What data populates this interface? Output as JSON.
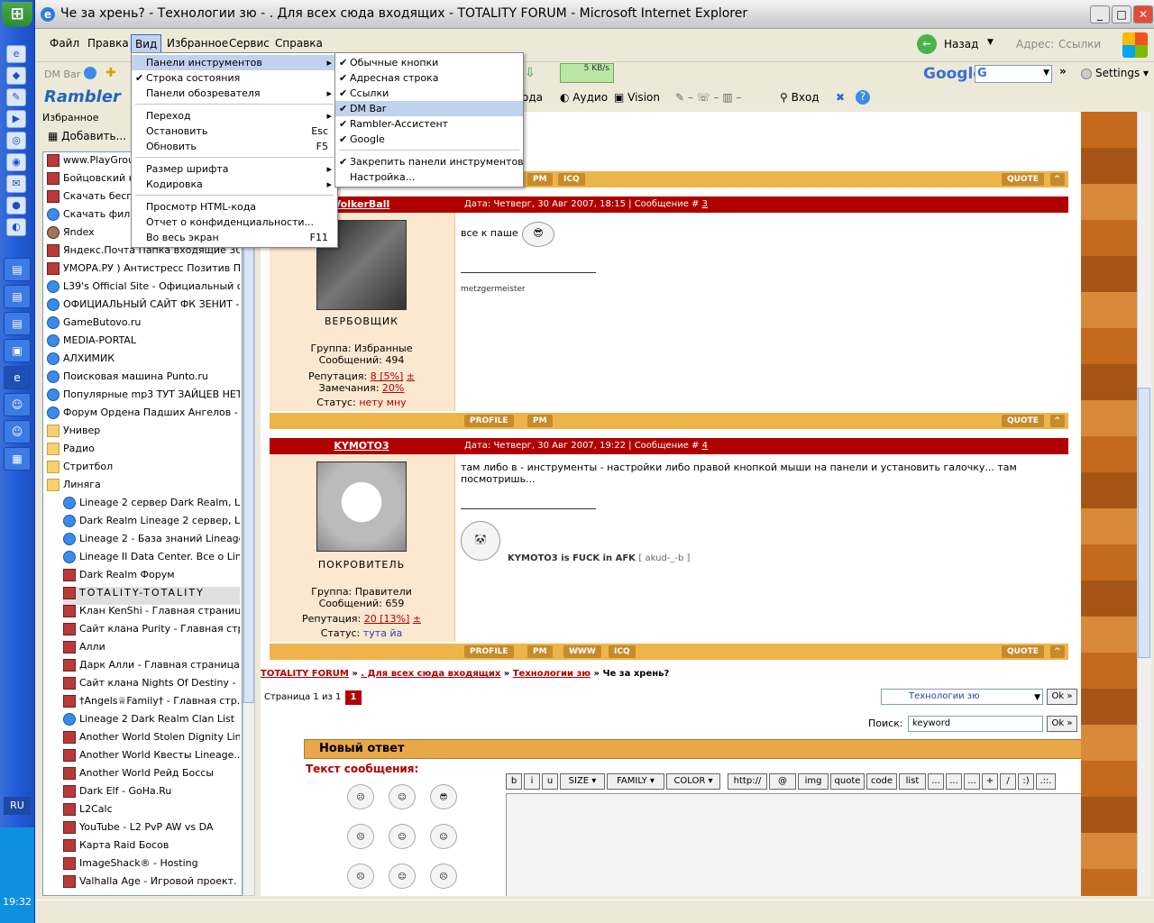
{
  "window": {
    "title": "Че за хрень? - Технологии зю - . Для всех сюда входящих - TOTALITY FORUM - Microsoft Internet Explorer"
  },
  "taskbar": {
    "lang": "RU",
    "clock": "19:32"
  },
  "menubar": {
    "items": [
      "Файл",
      "Правка",
      "Вид",
      "Избранное",
      "Сервис",
      "Справка"
    ]
  },
  "nav": {
    "back": "Назад",
    "address": "Адрес:",
    "links": "Ссылки"
  },
  "toolbar": {
    "dm_bar": "DM Bar",
    "speed": "5 KB/s",
    "google": "Google",
    "settings": "Settings"
  },
  "rambler": {
    "logo": "Rambler",
    "items": [
      "ода",
      "Аудио",
      "Vision",
      "Вход"
    ]
  },
  "view_menu": {
    "items": [
      {
        "label": "Панели инструментов",
        "arrow": true,
        "hl": true
      },
      {
        "label": "Строка состояния",
        "check": true
      },
      {
        "label": "Панели обозревателя",
        "arrow": true
      },
      {
        "label": "Переход",
        "arrow": true
      },
      {
        "label": "Остановить",
        "shortcut": "Esc"
      },
      {
        "label": "Обновить",
        "shortcut": "F5"
      },
      {
        "label": "Размер шрифта",
        "arrow": true
      },
      {
        "label": "Кодировка",
        "arrow": true
      },
      {
        "label": "Просмотр HTML-кода"
      },
      {
        "label": "Отчет о конфиденциальности..."
      },
      {
        "label": "Во весь экран",
        "shortcut": "F11"
      }
    ]
  },
  "toolbars_menu": {
    "items": [
      {
        "label": "Обычные кнопки",
        "check": true
      },
      {
        "label": "Адресная строка",
        "check": true
      },
      {
        "label": "Ссылки",
        "check": true
      },
      {
        "label": "DM Bar",
        "check": true,
        "hl": true
      },
      {
        "label": "Rambler-Ассистент",
        "check": true
      },
      {
        "label": "Google",
        "check": true
      },
      {
        "label": "Закрепить панели инструментов",
        "check": true
      },
      {
        "label": "Настройка..."
      }
    ]
  },
  "favorites": {
    "header": "Избранное",
    "add": "Добавить...",
    "items": [
      {
        "label": "www.PlayGrou",
        "t": "r"
      },
      {
        "label": "Бойцовский кл",
        "t": "r"
      },
      {
        "label": "Скачать бесп",
        "t": "r"
      },
      {
        "label": "Скачать филь",
        "t": "ie"
      },
      {
        "label": "Яndex",
        "t": "ya"
      },
      {
        "label": "Яндекс.Почта Папка входящие 30 ...",
        "t": "r"
      },
      {
        "label": "УМОРА.РУ ) Антистресс Позитив П...",
        "t": "r"
      },
      {
        "label": "L39's Official Site - Официальный са...",
        "t": "ie"
      },
      {
        "label": "ОФИЦИАЛЬНЫЙ САЙТ ФК ЗЕНИТ - П...",
        "t": "ie"
      },
      {
        "label": "GameButovo.ru",
        "t": "ie"
      },
      {
        "label": "MEDIA-PORTAL",
        "t": "ie"
      },
      {
        "label": "АЛХИМИК",
        "t": "ie"
      },
      {
        "label": "Поисковая машина Punto.ru",
        "t": "ie"
      },
      {
        "label": "Популярные mp3 ТУТ ЗАЙЦЕВ НЕТ! ...",
        "t": "ie"
      },
      {
        "label": "Форум Ордена Падших Ангелов - Ф...",
        "t": "ie"
      },
      {
        "label": "Универ",
        "t": "folder"
      },
      {
        "label": "Радио",
        "t": "folder"
      },
      {
        "label": "Стритбол",
        "t": "folder"
      },
      {
        "label": "Линяга",
        "t": "folder"
      },
      {
        "label": "Lineage 2 сервер Dark Realm, Lin...",
        "t": "ie",
        "sub": true
      },
      {
        "label": "Dark Realm Lineage 2 сервер, Lin...",
        "t": "ie",
        "sub": true
      },
      {
        "label": "Lineage 2 - База знаний Lineage...",
        "t": "ie",
        "sub": true
      },
      {
        "label": "Lineage II Data Center. Все о Lin...",
        "t": "ie",
        "sub": true
      },
      {
        "label": "Dark Realm Форум",
        "t": "r",
        "sub": true
      },
      {
        "label": "TOTALITY-TOTALITY",
        "t": "r",
        "sub": true,
        "sel": true
      },
      {
        "label": "Клан KenShi - Главная страница",
        "t": "r",
        "sub": true
      },
      {
        "label": "Сайт клана Purity - Главная стр...",
        "t": "r",
        "sub": true
      },
      {
        "label": "Алли",
        "t": "r",
        "sub": true
      },
      {
        "label": "Дарк Алли - Главная страница",
        "t": "r",
        "sub": true
      },
      {
        "label": "Сайт клана Nights Of Destiny - Г...",
        "t": "r",
        "sub": true
      },
      {
        "label": "†Angels♕Family† - Главная стр...",
        "t": "r",
        "sub": true
      },
      {
        "label": "Lineage 2 Dark Realm Clan List",
        "t": "ie",
        "sub": true
      },
      {
        "label": "Another World Stolen Dignity Lin...",
        "t": "r",
        "sub": true
      },
      {
        "label": "Another World Квесты Lineage...",
        "t": "r",
        "sub": true
      },
      {
        "label": "Another World Рейд Боссы",
        "t": "r",
        "sub": true
      },
      {
        "label": "Dark Elf - GoHa.Ru",
        "t": "r",
        "sub": true
      },
      {
        "label": "L2Calc",
        "t": "r",
        "sub": true
      },
      {
        "label": "YouTube - L2 PvP AW vs DA",
        "t": "r",
        "sub": true
      },
      {
        "label": "Карта Raid Босов",
        "t": "r",
        "sub": true
      },
      {
        "label": "ImageShack® - Hosting",
        "t": "r",
        "sub": true
      },
      {
        "label": "Valhalla Age - Игровой проект.",
        "t": "r",
        "sub": true
      }
    ]
  },
  "forum": {
    "buttons": {
      "pm": "PM",
      "icq": "ICQ",
      "quote": "QUOTE",
      "profile": "PROFILE",
      "www": "WWW"
    },
    "post1": {
      "author": "VolkerBall",
      "head": "Дата: Четверг, 30 Авг 2007, 18:15 | Сообщение # ",
      "num": "3",
      "rank": "ВЕРБОВЩИК",
      "group": "Группа: Избранные",
      "messages": "Сообщений: 494",
      "rep_label": "Репутация:",
      "rep": "8 [5%]",
      "warn_label": "Замечания:",
      "warn": "20%",
      "status_label": "Статус:",
      "status": "нету мну",
      "text": "все к паше",
      "sig": "metzgermeister"
    },
    "post2": {
      "author": "KYMOTO3",
      "head": "Дата: Четверг, 30 Авг 2007, 19:22 | Сообщение # ",
      "num": "4",
      "rank": "ПОКРОВИТЕЛЬ",
      "group": "Группа: Правители",
      "messages": "Сообщений: 659",
      "rep_label": "Репутация:",
      "rep": "20 [13%]",
      "status_label": "Статус:",
      "status": "тута йа",
      "text": "там либо в - инструменты - настройки либо правой кнопкой мыши на панели и установить галочку... там посмотришь...",
      "sig": "KYMOTO3 is FUCK in AFK",
      "sig2": "[ akud-_-b ]"
    },
    "breadcrumb": {
      "a": "TOTALITY FORUM",
      "b": ". Для всех сюда входящих",
      "c": "Технологии зю",
      "d": "Че за хрень?"
    },
    "pages": "Страница 1 из 1",
    "page_num": "1",
    "section_select": "Технологии зю",
    "ok": "Ok »",
    "search_label": "Поиск:",
    "search_value": "keyword",
    "new_reply": "Новый ответ",
    "msg_label": "Текст сообщения:",
    "editor_buttons": [
      "b",
      "i",
      "u",
      "SIZE",
      "FAMILY",
      "COLOR",
      "http://",
      "@",
      "img",
      "quote",
      "code",
      "list",
      "...",
      "...",
      "...",
      "+",
      "/",
      ":)",
      ".::."
    ]
  }
}
